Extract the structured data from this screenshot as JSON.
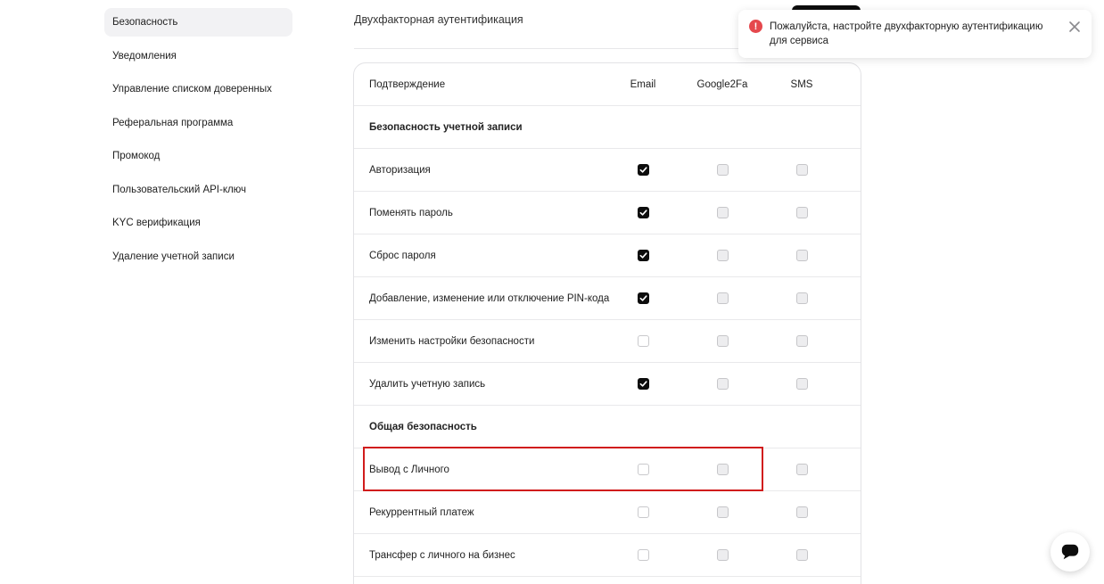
{
  "sidebar": {
    "items": [
      {
        "label": "Безопасность",
        "active": true
      },
      {
        "label": "Уведомления"
      },
      {
        "label": "Управление списком доверенных"
      },
      {
        "label": "Реферальная программа"
      },
      {
        "label": "Промокод"
      },
      {
        "label": "Пользовательский API-ключ"
      },
      {
        "label": "KYC верификация"
      },
      {
        "label": "Удаление учетной записи"
      }
    ]
  },
  "header": {
    "title": "Двухфакторная аутентификация"
  },
  "table": {
    "headers": {
      "label": "Подтверждение",
      "email": "Email",
      "google": "Google2Fa",
      "sms": "SMS"
    },
    "rows": [
      {
        "type": "section",
        "label": "Безопасность учетной записи"
      },
      {
        "type": "row",
        "label": "Авторизация",
        "email": "checked",
        "google": "disabled",
        "sms": "disabled"
      },
      {
        "type": "row",
        "label": "Поменять пароль",
        "email": "checked",
        "google": "disabled",
        "sms": "disabled"
      },
      {
        "type": "row",
        "label": "Сброс пароля",
        "email": "checked",
        "google": "disabled",
        "sms": "disabled"
      },
      {
        "type": "row",
        "label": "Добавление, изменение или отключение PIN-кода",
        "email": "checked",
        "google": "disabled",
        "sms": "disabled"
      },
      {
        "type": "row",
        "label": "Изменить настройки безопасности",
        "email": "unchecked",
        "google": "disabled",
        "sms": "disabled"
      },
      {
        "type": "row",
        "label": "Удалить учетную запись",
        "email": "checked",
        "google": "disabled",
        "sms": "disabled"
      },
      {
        "type": "section",
        "label": "Общая безопасность"
      },
      {
        "type": "row",
        "label": "Вывод с Личного",
        "email": "unchecked",
        "google": "disabled",
        "sms": "disabled"
      },
      {
        "type": "row",
        "label": "Рекуррентный платеж",
        "email": "unchecked",
        "google": "disabled",
        "sms": "disabled"
      },
      {
        "type": "row",
        "label": "Трансфер с личного на бизнес",
        "email": "unchecked",
        "google": "disabled",
        "sms": "disabled"
      }
    ]
  },
  "toast": {
    "message": "Пожалуйста, настройте двухфакторную аутентификацию для сервиса",
    "icon": "exclamation-icon",
    "color": "#e5484d"
  },
  "colors": {
    "accent": "#0d0d0d",
    "highlight": "#d11c1c"
  }
}
